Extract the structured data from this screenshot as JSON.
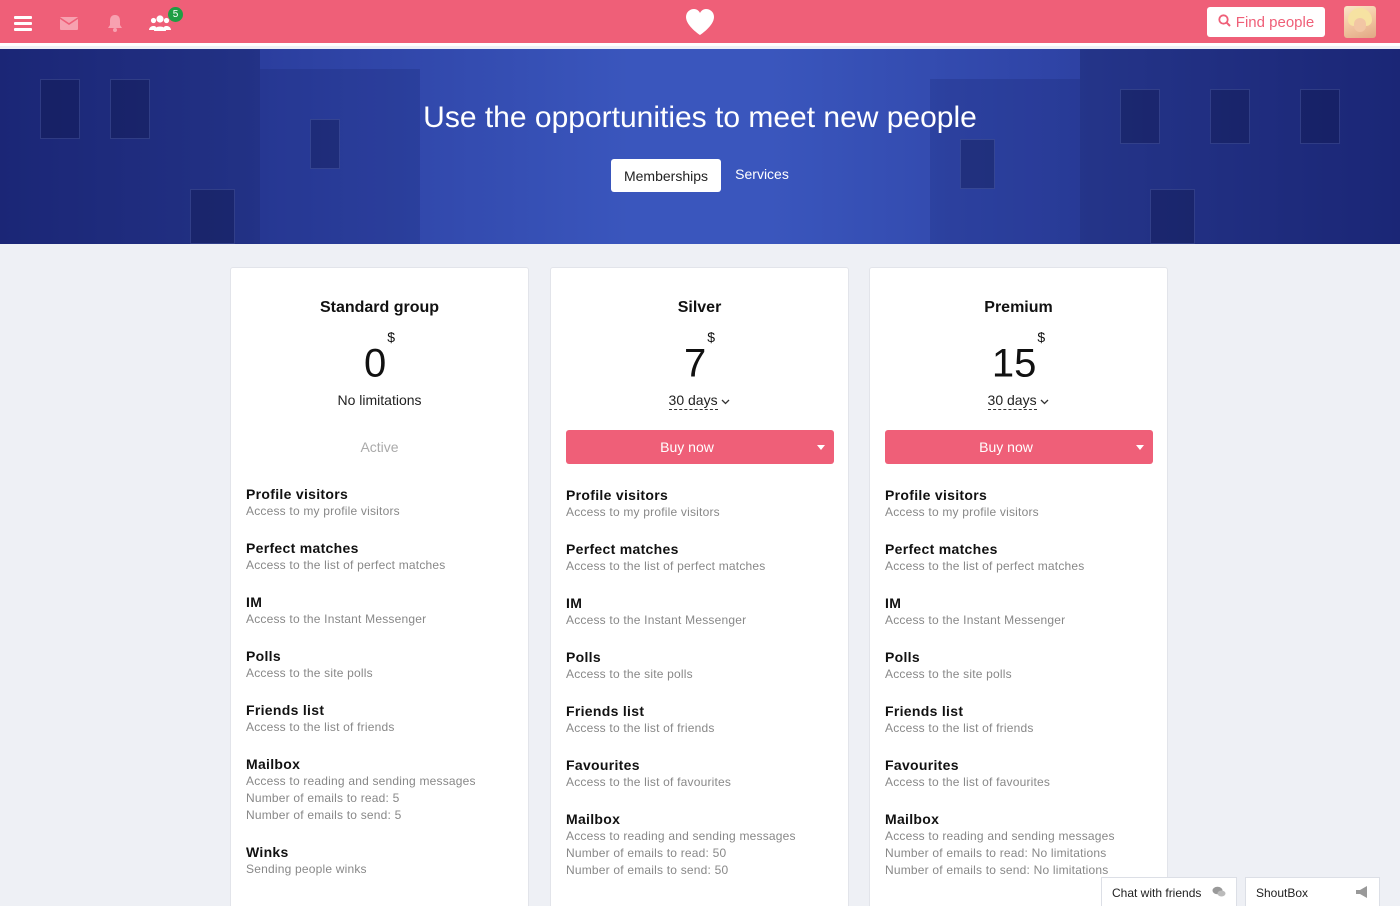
{
  "topbar": {
    "menu_icon": "hamburger-menu-icon",
    "mail_icon": "envelope-icon",
    "notifications_icon": "bell-icon",
    "friends_icon": "users-icon",
    "friends_badge": "5",
    "logo_icon": "heart-icon",
    "find_people_label": "Find people",
    "find_people_icon": "search-icon",
    "avatar_icon": "user-avatar",
    "bg_color": "#ef5f78",
    "badge_color": "#1f9e43"
  },
  "hero": {
    "title": "Use the opportunities to meet new people",
    "tabs": [
      {
        "label": "Memberships",
        "active": true
      },
      {
        "label": "Services",
        "active": false
      }
    ]
  },
  "plans": [
    {
      "name": "Standard group",
      "price": "0",
      "currency": "$",
      "subtitle": "No limitations",
      "status": "Active",
      "features": [
        {
          "title": "Profile visitors",
          "desc": [
            "Access to my profile visitors"
          ]
        },
        {
          "title": "Perfect matches",
          "desc": [
            "Access to the list of perfect matches"
          ]
        },
        {
          "title": "IM",
          "desc": [
            "Access to the Instant Messenger"
          ]
        },
        {
          "title": "Polls",
          "desc": [
            "Access to the site polls"
          ]
        },
        {
          "title": "Friends list",
          "desc": [
            "Access to the list of friends"
          ]
        },
        {
          "title": "Mailbox",
          "desc": [
            "Access to reading and sending messages",
            "Number of emails to read: 5",
            "Number of emails to send: 5"
          ]
        },
        {
          "title": "Winks",
          "desc": [
            "Sending people winks"
          ]
        }
      ]
    },
    {
      "name": "Silver",
      "price": "7",
      "currency": "$",
      "period": "30 days",
      "buy_label": "Buy now",
      "features": [
        {
          "title": "Profile visitors",
          "desc": [
            "Access to my profile visitors"
          ]
        },
        {
          "title": "Perfect matches",
          "desc": [
            "Access to the list of perfect matches"
          ]
        },
        {
          "title": "IM",
          "desc": [
            "Access to the Instant Messenger"
          ]
        },
        {
          "title": "Polls",
          "desc": [
            "Access to the site polls"
          ]
        },
        {
          "title": "Friends list",
          "desc": [
            "Access to the list of friends"
          ]
        },
        {
          "title": "Favourites",
          "desc": [
            "Access to the list of favourites"
          ]
        },
        {
          "title": "Mailbox",
          "desc": [
            "Access to reading and sending messages",
            "Number of emails to read: 50",
            "Number of emails to send: 50"
          ]
        }
      ]
    },
    {
      "name": "Premium",
      "price": "15",
      "currency": "$",
      "period": "30 days",
      "buy_label": "Buy now",
      "features": [
        {
          "title": "Profile visitors",
          "desc": [
            "Access to my profile visitors"
          ]
        },
        {
          "title": "Perfect matches",
          "desc": [
            "Access to the list of perfect matches"
          ]
        },
        {
          "title": "IM",
          "desc": [
            "Access to the Instant Messenger"
          ]
        },
        {
          "title": "Polls",
          "desc": [
            "Access to the site polls"
          ]
        },
        {
          "title": "Friends list",
          "desc": [
            "Access to the list of friends"
          ]
        },
        {
          "title": "Favourites",
          "desc": [
            "Access to the list of favourites"
          ]
        },
        {
          "title": "Mailbox",
          "desc": [
            "Access to reading and sending messages",
            "Number of emails to read: No limitations",
            "Number of emails to send: No limitations"
          ]
        }
      ]
    }
  ],
  "chat": {
    "friends_label": "Chat with friends",
    "friends_icon": "chat-bubbles-icon",
    "shoutbox_label": "ShoutBox",
    "shoutbox_icon": "megaphone-icon"
  }
}
